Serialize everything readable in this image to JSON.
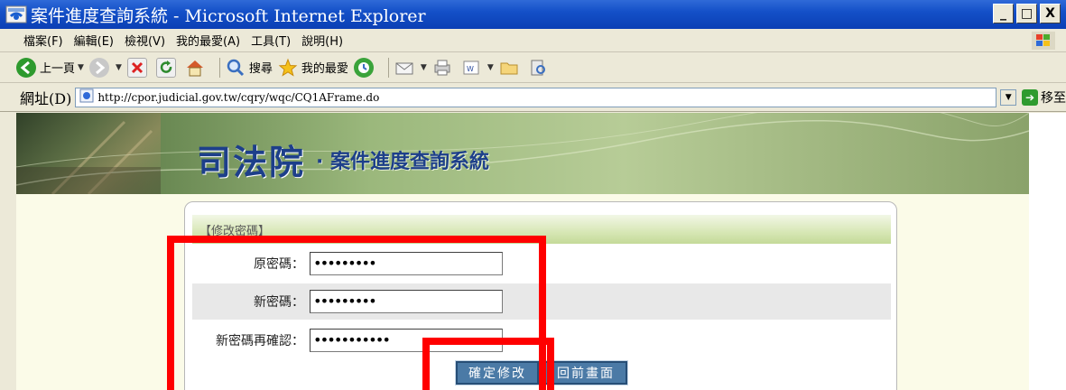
{
  "window": {
    "title": "案件進度查詢系統 - Microsoft Internet Explorer",
    "buttons": [
      "_",
      "□",
      "X"
    ]
  },
  "menubar": {
    "items": [
      "檔案(F)",
      "編輯(E)",
      "檢視(V)",
      "我的最愛(A)",
      "工具(T)",
      "說明(H)"
    ]
  },
  "toolbar": {
    "back_label": "上一頁",
    "search_label": "搜尋",
    "favorites_label": "我的最愛"
  },
  "addressbar": {
    "label": "網址(D)",
    "url": "http://cpor.judicial.gov.tw/cqry/wqc/CQ1AFrame.do",
    "go_label": "移至"
  },
  "banner": {
    "org": "司法院",
    "system": "· 案件進度查詢系統"
  },
  "form": {
    "section_title": "【修改密碼】",
    "fields": [
      {
        "label": "原密碼：",
        "value": "•••••••••"
      },
      {
        "label": "新密碼：",
        "value": "•••••••••"
      },
      {
        "label": "新密碼再確認：",
        "value": "•••••••••••"
      }
    ],
    "submit_label": "確定修改",
    "back_label": "回前畫面"
  },
  "colors": {
    "titlebar": "#0b3fb5",
    "annotation": "#ff0000",
    "button": "#4b7aa6",
    "banner_text": "#1d3f8a"
  }
}
